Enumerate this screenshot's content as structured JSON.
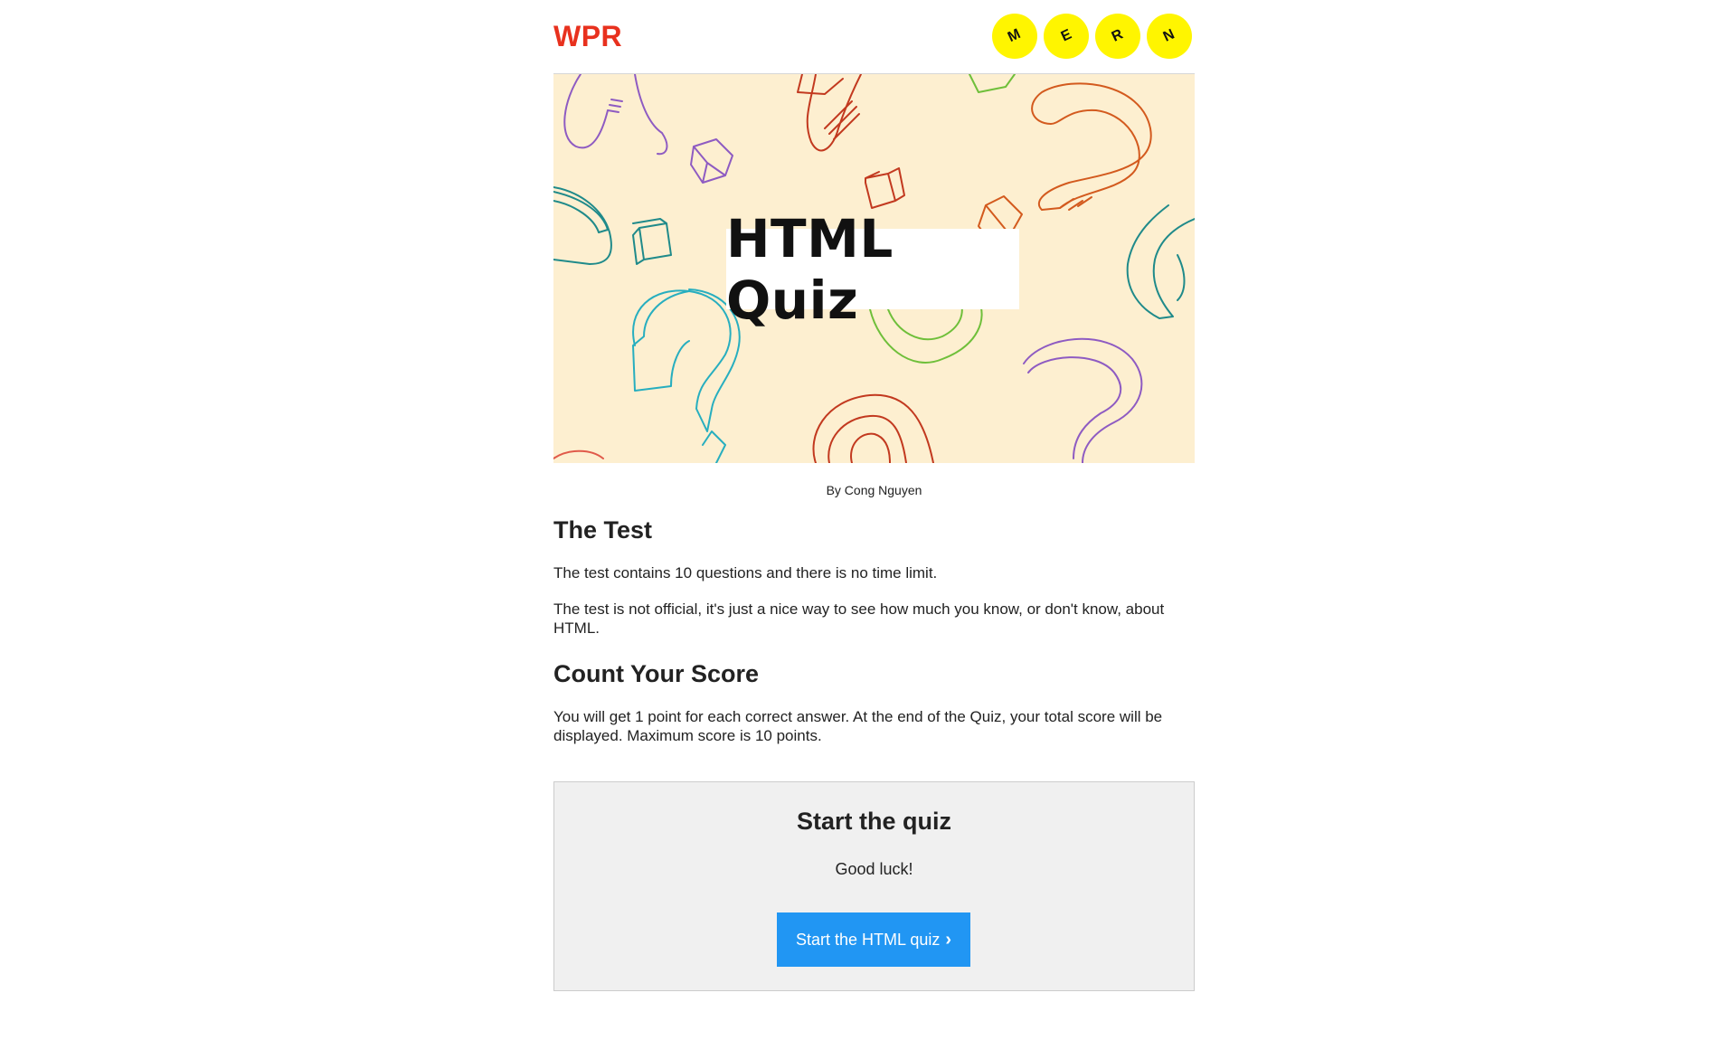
{
  "header": {
    "logo": "WPR",
    "avatars": [
      "M",
      "E",
      "R",
      "N"
    ]
  },
  "banner": {
    "title": "HTML Quiz"
  },
  "byline": "By Cong Nguyen",
  "sections": [
    {
      "heading": "The Test",
      "paragraphs": [
        "The test contains 10 questions and there is no time limit.",
        "The test is not official, it's just a nice way to see how much you know, or don't know, about HTML."
      ]
    },
    {
      "heading": "Count Your Score",
      "paragraphs": [
        "You will get 1 point for each correct answer. At the end of the Quiz, your total score will be displayed. Maximum score is 10 points."
      ]
    }
  ],
  "start_box": {
    "title": "Start the quiz",
    "subtitle": "Good luck!",
    "button_label": "Start the HTML quiz",
    "button_icon": "chevron-right-icon"
  },
  "colors": {
    "logo": "#e8311e",
    "avatar": "#fff500",
    "banner_bg": "#fdefd0",
    "button": "#2196f3",
    "start_box_bg": "#f0f0f0"
  }
}
